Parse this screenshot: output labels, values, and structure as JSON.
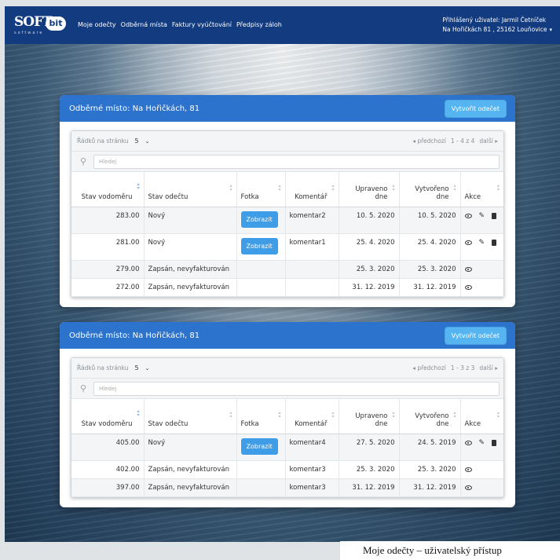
{
  "navbar": {
    "logo_text": "SOFT",
    "logo_bit": "bit",
    "logo_sub": "software",
    "links": [
      "Moje odečty",
      "Odběrná místa",
      "Faktury vyúčtování",
      "Předpisy záloh"
    ],
    "user_line1": "Přihlášený uživatel: Jarmil Četníček",
    "user_line2": "Na Hořičkách 81 , 25162 Louňovice"
  },
  "columns": [
    "Stav vodoměru",
    "Stav odečtu",
    "Fotka",
    "Komentář",
    "Upraveno dne",
    "Vytvořeno dne",
    "Akce"
  ],
  "cards": [
    {
      "title": "Odběrné místo: Na Hořičkách, 81",
      "create_button": "Vytvořit odečet",
      "rows_label": "Řádků na stránku",
      "rows_value": "5",
      "prev_label": "◂ předchozí",
      "range": "1 - 4 z 4",
      "next_label": "další ▸",
      "search_placeholder": "Hledej",
      "rows": [
        {
          "stav": "283.00",
          "status": "Nový",
          "foto": "Zobrazit",
          "komentar": "komentar2",
          "upraveno": "10. 5. 2020",
          "vytvoreno": "10. 5. 2020",
          "edit": true
        },
        {
          "stav": "281.00",
          "status": "Nový",
          "foto": "Zobrazit",
          "komentar": "komentar1",
          "upraveno": "25. 4. 2020",
          "vytvoreno": "25. 4. 2020",
          "edit": true
        },
        {
          "stav": "279.00",
          "status": "Zapsán, nevyfakturován",
          "foto": "",
          "komentar": "",
          "upraveno": "25. 3. 2020",
          "vytvoreno": "25. 3. 2020",
          "edit": false
        },
        {
          "stav": "272.00",
          "status": "Zapsán, nevyfakturován",
          "foto": "",
          "komentar": "",
          "upraveno": "31. 12. 2019",
          "vytvoreno": "31. 12. 2019",
          "edit": false
        }
      ]
    },
    {
      "title": "Odběrné místo: Na Hořičkách, 81",
      "create_button": "Vytvořit odečet",
      "rows_label": "Řádků na stránku",
      "rows_value": "5",
      "prev_label": "◂ předchozí",
      "range": "1 - 3 z 3",
      "next_label": "další ▸",
      "search_placeholder": "Hledej",
      "rows": [
        {
          "stav": "405.00",
          "status": "Nový",
          "foto": "Zobrazit",
          "komentar": "komentar4",
          "upraveno": "27. 5. 2020",
          "vytvoreno": "24. 5. 2019",
          "edit": true
        },
        {
          "stav": "402.00",
          "status": "Zapsán, nevyfakturován",
          "foto": "",
          "komentar": "komentar3",
          "upraveno": "25. 3. 2020",
          "vytvoreno": "25. 3. 2020",
          "edit": false
        },
        {
          "stav": "397.00",
          "status": "Zapsán, nevyfakturován",
          "foto": "",
          "komentar": "komentar3",
          "upraveno": "31. 12. 2019",
          "vytvoreno": "31. 12. 2019",
          "edit": false
        }
      ]
    }
  ],
  "caption": "Moje odečty – uživatelský přístup"
}
